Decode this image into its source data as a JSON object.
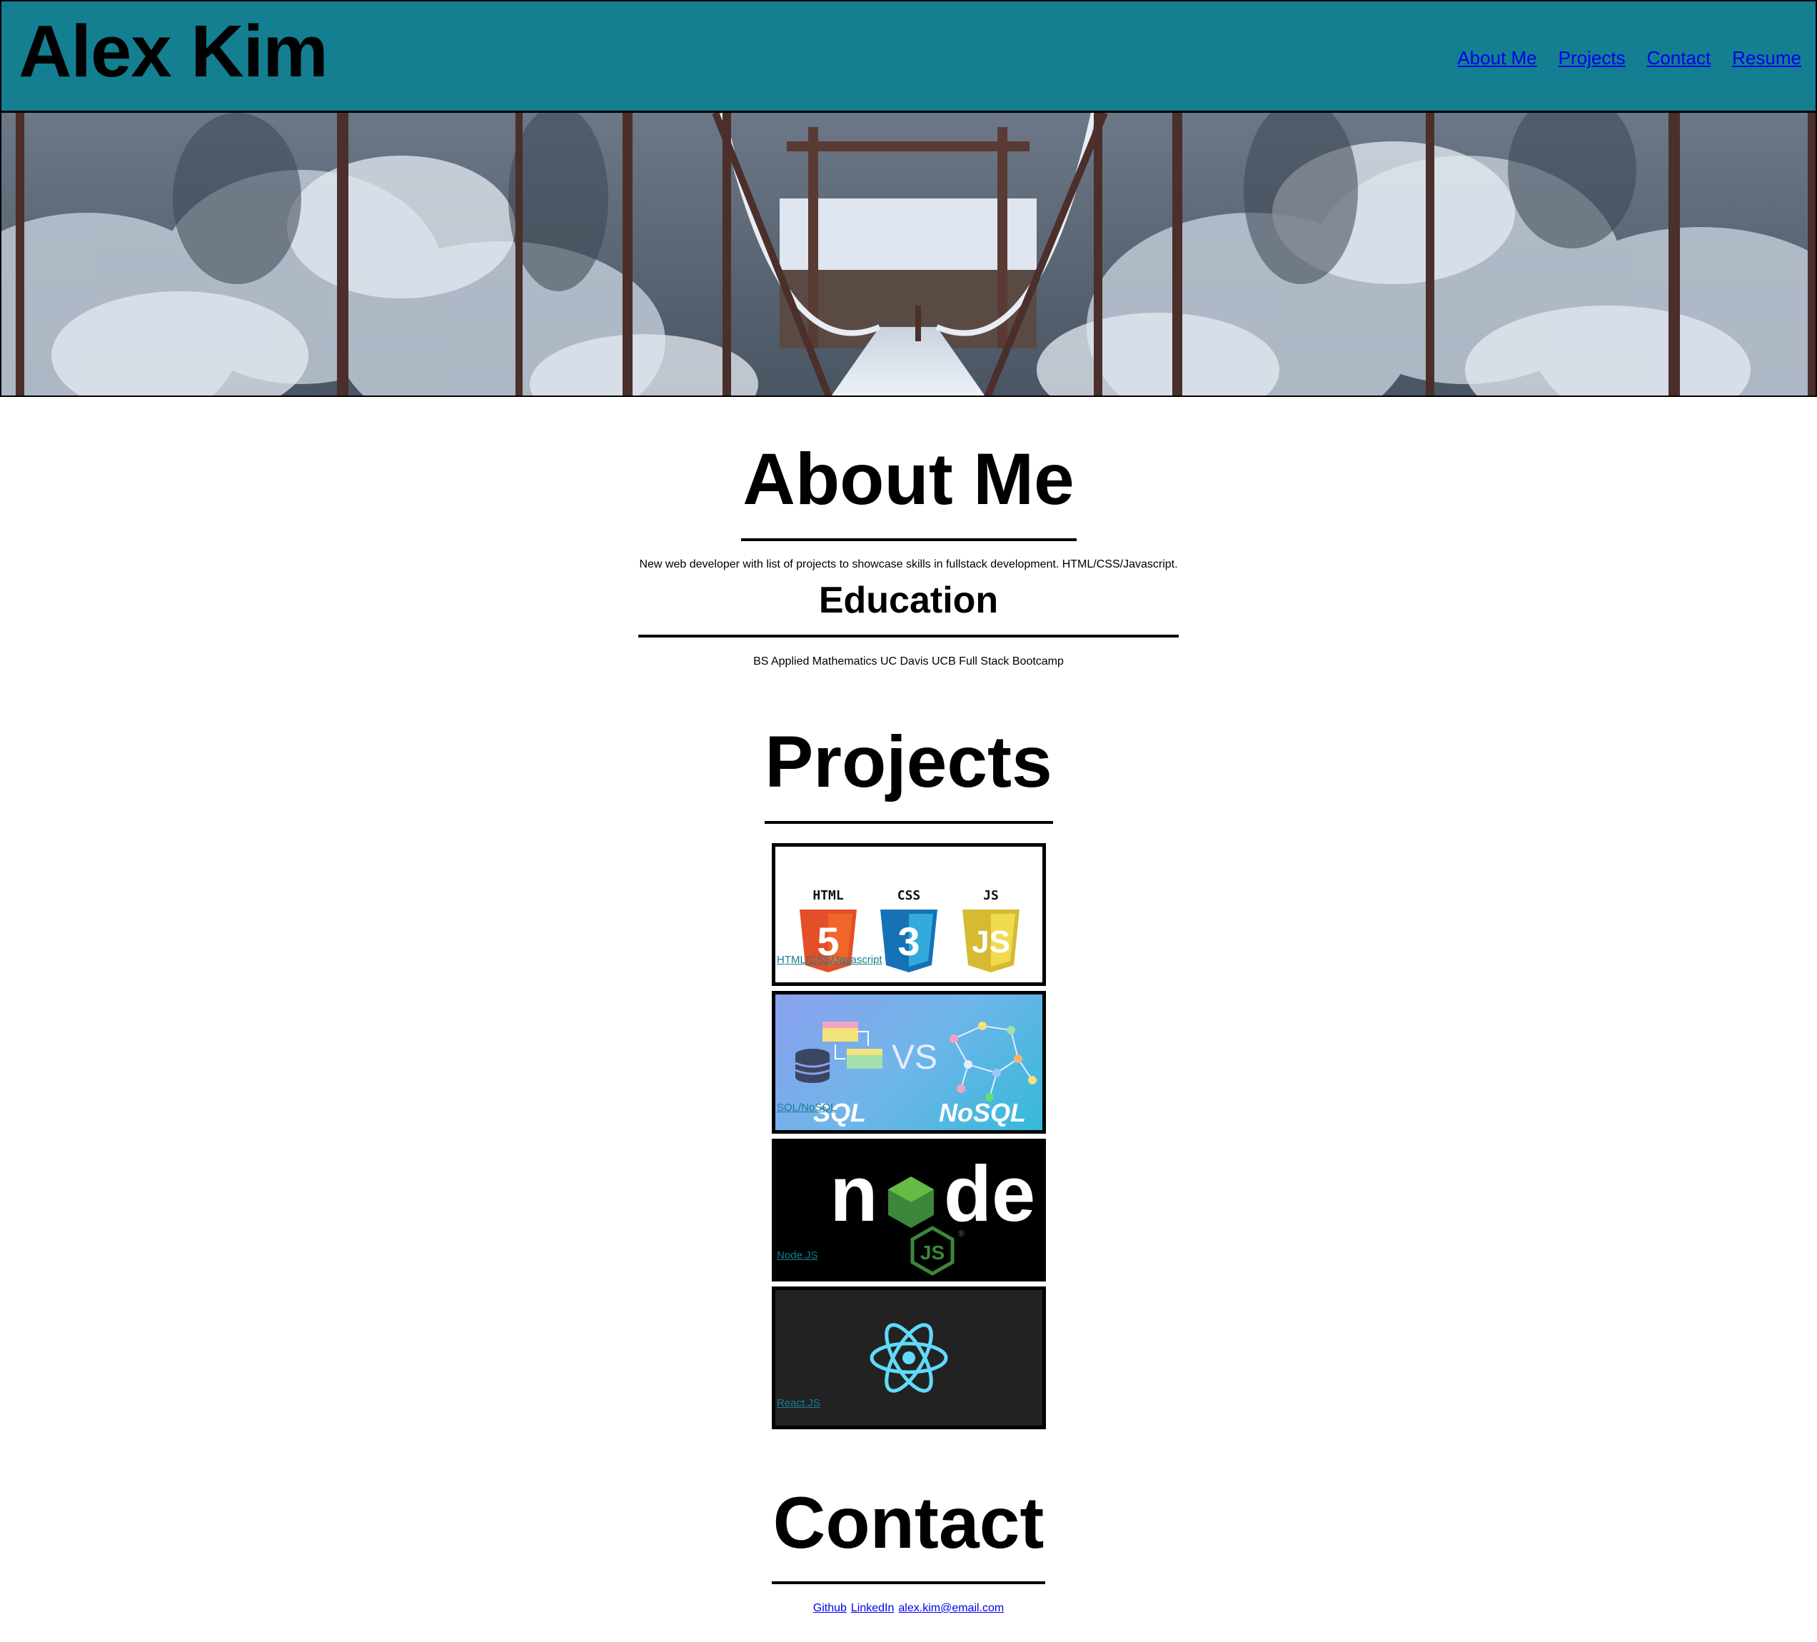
{
  "header": {
    "title": "Alex Kim",
    "nav": [
      "About Me",
      "Projects",
      "Contact",
      "Resume"
    ]
  },
  "hero": {
    "description": ""
  },
  "about": {
    "title": "About Me",
    "text": "New web developer with list of projects to showcase skills in fullstack development. HTML/CSS/Javascript.",
    "education_title": "Education",
    "education_text": "BS Applied Mathematics UC Davis  UCB Full Stack Bootcamp"
  },
  "projects": {
    "title": "Projects",
    "items": [
      {
        "label": "HTML/CSS/Javascript",
        "badges": [
          "HTML",
          "CSS",
          "JS"
        ],
        "digits": [
          "5",
          "3",
          "JS"
        ]
      },
      {
        "label": "SQL/NoSQL",
        "left": "SQL",
        "vs": "VS",
        "right": "NoSQL"
      },
      {
        "label": "Node.JS",
        "word_a": "n",
        "word_b": "de",
        "badge": "JS",
        "mark": "®"
      },
      {
        "label": "React.JS"
      }
    ]
  },
  "contact": {
    "title": "Contact",
    "links": [
      "Github",
      "LinkedIn",
      "alex.kim@email.com"
    ]
  },
  "colors": {
    "header_bg": "#137f91",
    "link": "#0000ee",
    "project_link": "#137f91",
    "html5": "#e34f26",
    "css3": "#1572b6",
    "js": "#f0db4f",
    "node_green": "#3c873a",
    "react": "#61dafb"
  }
}
